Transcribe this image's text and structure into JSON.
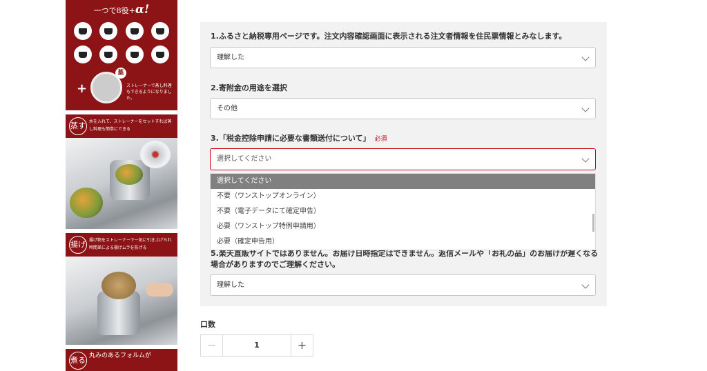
{
  "product_image": {
    "header": "一つで8役+",
    "header_alpha": "α!",
    "steam_badge": "蒸",
    "strainer_caption": "ストレーナーで蒸し料理もできるようになりました。",
    "steam_section": {
      "icon_text": "蒸す",
      "description": "水を入れて、ストレーナーをセットすれば蒸し料理も簡単にできる"
    },
    "fry_section": {
      "icon_text": "揚げる",
      "description": "揚げ物をストレーナーで一気に引き上げられ時間差による揚げムラを防げる"
    },
    "bottom_section": {
      "icon_text": "煮る",
      "description": "丸みのあるフォルムが"
    }
  },
  "form": {
    "q1": {
      "label": "1.ふるさと納税専用ページです。注文内容確認画面に表示される注文者情報を住民票情報とみなします。",
      "value": "理解した"
    },
    "q2": {
      "label": "2.寄附金の用途を選択",
      "value": "その他"
    },
    "q3": {
      "label": "3.「税金控除申請に必要な書類送付について」",
      "required": "必須",
      "value": "選択してください",
      "options": [
        "選択してください",
        "不要（ワンストップオンライン）",
        "不要（電子データにて確定申告）",
        "必要（ワンストップ特例申請用）",
        "必要（確定申告用）"
      ]
    },
    "q5": {
      "label": "5.楽天直販サイトではありません。お届け日時指定はできません。返信メールや「お礼の品」のお届けが遅くなる場合がありますのでご理解ください。",
      "value": "理解した"
    }
  },
  "quantity": {
    "label": "口数",
    "value": "1",
    "minus": "−",
    "plus": "+"
  }
}
